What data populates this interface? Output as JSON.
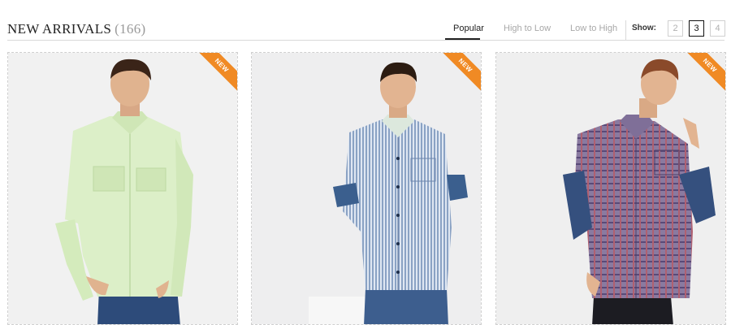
{
  "header": {
    "title": "NEW ARRIVALS",
    "count": "(166)"
  },
  "sort": {
    "options": [
      {
        "label": "Popular",
        "active": true
      },
      {
        "label": "High to Low",
        "active": false
      },
      {
        "label": "Low to High",
        "active": false
      }
    ]
  },
  "show": {
    "label": "Show:",
    "options": [
      "2",
      "3",
      "4"
    ],
    "selected": "3"
  },
  "products": [
    {
      "badge": "NEW",
      "description": "light green long-sleeve shirt",
      "shirt_color": "#dcefc8"
    },
    {
      "badge": "NEW",
      "description": "blue striped shirt with paisley cuffs",
      "shirt_color": "#c6d3e6"
    },
    {
      "badge": "NEW",
      "description": "purple check shirt with paisley sleeves",
      "shirt_color": "#7b6a8f"
    }
  ],
  "colors": {
    "badge": "#f08a24",
    "active_text": "#222222",
    "inactive_text": "#a8a8a8",
    "border": "#d9d9d9"
  }
}
